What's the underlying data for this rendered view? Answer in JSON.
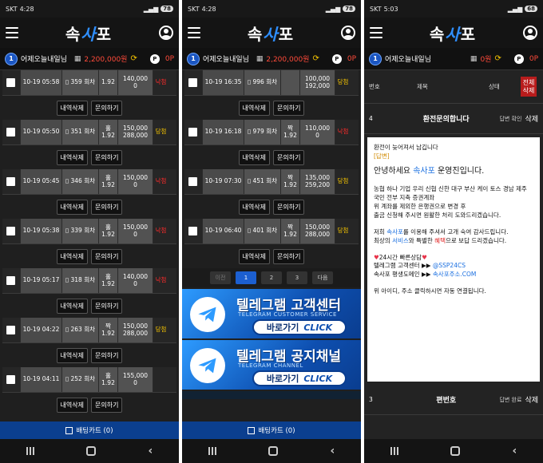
{
  "app": {
    "logo_left": "속",
    "logo_mid": "사",
    "logo_right": "포",
    "user_name": "어제오늘내일님",
    "level": "1",
    "point_label": "P",
    "cart_label": "배팅카트 (0)"
  },
  "panel1": {
    "status_time": "4:28",
    "status_carrier": "SKT",
    "battery": "78",
    "money": "2,200,000원",
    "points": "0P",
    "bets": [
      {
        "date": "10-19 05:58",
        "round": "359 회차",
        "pick": "",
        "odds": "1.92",
        "amt1": "140,000",
        "amt2": "0",
        "status": "낙첨",
        "win": false
      },
      {
        "date": "10-19 05:50",
        "round": "351 회차",
        "pick": "홀",
        "odds": "1.92",
        "amt1": "150,000",
        "amt2": "288,000",
        "status": "당첨",
        "win": true
      },
      {
        "date": "10-19 05:45",
        "round": "346 회차",
        "pick": "홀",
        "odds": "1.92",
        "amt1": "150,000",
        "amt2": "0",
        "status": "낙첨",
        "win": false
      },
      {
        "date": "10-19 05:38",
        "round": "339 회차",
        "pick": "홀",
        "odds": "1.92",
        "amt1": "150,000",
        "amt2": "0",
        "status": "낙첨",
        "win": false
      },
      {
        "date": "10-19 05:17",
        "round": "318 회차",
        "pick": "홀",
        "odds": "1.92",
        "amt1": "140,000",
        "amt2": "0",
        "status": "낙첨",
        "win": false
      },
      {
        "date": "10-19 04:22",
        "round": "263 회차",
        "pick": "짝",
        "odds": "1.92",
        "amt1": "150,000",
        "amt2": "288,000",
        "status": "당첨",
        "win": true
      },
      {
        "date": "10-19 04:11",
        "round": "252 회차",
        "pick": "홀",
        "odds": "1.92",
        "amt1": "155,000",
        "amt2": "0",
        "status": "",
        "win": false
      }
    ],
    "btn_delete": "내역삭제",
    "btn_inquire": "문의하기"
  },
  "panel2": {
    "status_time": "4:28",
    "status_carrier": "SKT",
    "battery": "78",
    "money": "2,200,000원",
    "points": "0P",
    "bets": [
      {
        "date": "10-19 16:35",
        "round": "996 회차",
        "pick": "",
        "odds": "",
        "amt1": "100,000",
        "amt2": "192,000",
        "status": "당첨",
        "win": true
      },
      {
        "date": "10-19 16:18",
        "round": "979 회차",
        "pick": "짝",
        "odds": "1.92",
        "amt1": "110,000",
        "amt2": "0",
        "status": "낙첨",
        "win": false
      },
      {
        "date": "10-19 07:30",
        "round": "451 회차",
        "pick": "짝",
        "odds": "1.92",
        "amt1": "135,000",
        "amt2": "259,200",
        "status": "당첨",
        "win": true
      },
      {
        "date": "10-19 06:40",
        "round": "401 회차",
        "pick": "짝",
        "odds": "1.92",
        "amt1": "150,000",
        "amt2": "288,000",
        "status": "당첨",
        "win": true
      }
    ],
    "btn_delete": "내역삭제",
    "btn_inquire": "문의하기",
    "pager": {
      "prev": "이전",
      "p1": "1",
      "p2": "2",
      "p3": "3",
      "next": "다음"
    },
    "banner1": {
      "title": "텔레그램 고객센터",
      "sub": "TELEGRAM CUSTOMER SERVICE",
      "btn": "바로가기",
      "click": "CLICK"
    },
    "banner2": {
      "title": "텔레그램 공지채널",
      "sub": "TELEGRAM CHANNEL",
      "btn": "바로가기",
      "click": "CLICK"
    }
  },
  "panel3": {
    "status_time": "5:03",
    "status_carrier": "SKT",
    "battery": "68",
    "money": "0원",
    "points": "0P",
    "head": {
      "no": "번호",
      "title": "제목",
      "state": "상태",
      "del_all": "전체삭제"
    },
    "row1": {
      "no": "4",
      "title": "환전문의합니다",
      "state": "답변 확인",
      "del": "삭제"
    },
    "answer": {
      "q": "환전이 늦어져서 남깁니다",
      "tag": "[답변]",
      "greet_pre": "안녕하세요 ",
      "brand": "속사포",
      "greet_post": " 운영진입니다.",
      "p1": "농협 하나 기업 우리 신협 신한 대구 부산 케이 토스 경남 제주 국민 전부 지축 증권계좌",
      "p2": "위 계좌를 제외한 은행권으로 변경 후",
      "p3": "출금 신청해 주시면 원활한 처리 도와드리겠습니다.",
      "t1_pre": "저희 ",
      "t1_post": "를 이용해 주셔서 고개 숙여 감사드립니다.",
      "t2_pre": "최상의 ",
      "t2_service": "서비스",
      "t2_mid": "와 특별한 ",
      "t2_benefit": "혜택",
      "t2_post": "으로 보답 드리겠습니다.",
      "fast": "24시간 빠른상담",
      "tg_label": "텔레그램 고객센터 ▶▶ ",
      "tg_id": "@SSP24CS",
      "domain_label": "속사포 평생도메인 ▶▶ ",
      "domain": "속사포주소.COM",
      "auto": "위 아이디, 주소 클릭하시면 자동 연결됩니다."
    },
    "row2": {
      "no": "3",
      "title": "편번호",
      "state": "답변 완료",
      "del": "삭제"
    }
  }
}
